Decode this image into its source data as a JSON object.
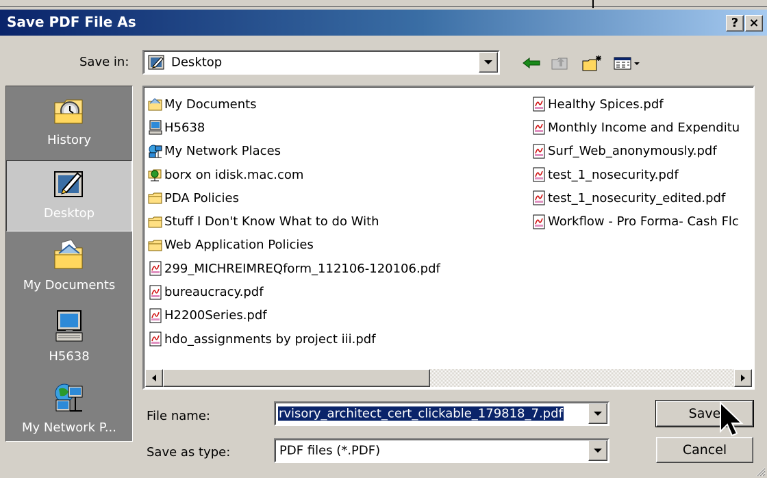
{
  "window": {
    "title": "Save PDF File As"
  },
  "title_buttons": {
    "help": "?",
    "close": "×"
  },
  "save_in": {
    "label": "Save in:",
    "value": "Desktop"
  },
  "toolbar": {
    "icons": [
      "back-arrow-icon",
      "up-folder-icon",
      "new-folder-icon",
      "view-menu-icon"
    ]
  },
  "places": [
    {
      "label": "History",
      "icon": "history-icon",
      "selected": false
    },
    {
      "label": "Desktop",
      "icon": "desktop-icon",
      "selected": true
    },
    {
      "label": "My Documents",
      "icon": "my-documents-icon",
      "selected": false
    },
    {
      "label": "H5638",
      "icon": "computer-icon",
      "selected": false
    },
    {
      "label": "My Network P...",
      "icon": "network-places-icon",
      "selected": false
    }
  ],
  "files_col1": [
    {
      "name": "My Documents",
      "icon": "my-documents-icon"
    },
    {
      "name": "H5638",
      "icon": "computer-icon"
    },
    {
      "name": "My Network Places",
      "icon": "network-places-icon"
    },
    {
      "name": "borx on idisk.mac.com",
      "icon": "network-folder-icon"
    },
    {
      "name": "PDA Policies",
      "icon": "folder-icon"
    },
    {
      "name": "Stuff I Don't Know What to do With",
      "icon": "folder-icon"
    },
    {
      "name": "Web Application Policies",
      "icon": "folder-icon"
    },
    {
      "name": "299_MICHREIMREQform_112106-120106.pdf",
      "icon": "pdf-file-icon"
    },
    {
      "name": "bureaucracy.pdf",
      "icon": "pdf-file-icon"
    },
    {
      "name": "H2200Series.pdf",
      "icon": "pdf-file-icon"
    },
    {
      "name": "hdo_assignments by project iii.pdf",
      "icon": "pdf-file-icon"
    }
  ],
  "files_col2": [
    {
      "name": "Healthy Spices.pdf",
      "icon": "pdf-file-icon"
    },
    {
      "name": "Monthly Income and Expenditu",
      "icon": "pdf-file-icon"
    },
    {
      "name": "Surf_Web_anonymously.pdf",
      "icon": "pdf-file-icon"
    },
    {
      "name": "test_1_nosecurity.pdf",
      "icon": "pdf-file-icon"
    },
    {
      "name": "test_1_nosecurity_edited.pdf",
      "icon": "pdf-file-icon"
    },
    {
      "name": "Workflow - Pro Forma- Cash Flc",
      "icon": "pdf-file-icon"
    }
  ],
  "file_name": {
    "label": "File name:",
    "value": "rvisory_architect_cert_clickable_179818_7.pdf"
  },
  "save_as_type": {
    "label": "Save as type:",
    "value": "PDF files (*.PDF)"
  },
  "buttons": {
    "save": "Save",
    "cancel": "Cancel"
  }
}
